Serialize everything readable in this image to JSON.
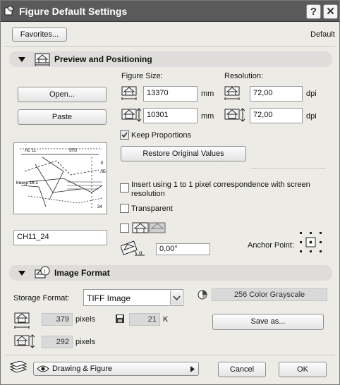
{
  "window": {
    "title": "Figure Default Settings",
    "help_glyph": "?",
    "close_glyph": "✕"
  },
  "top": {
    "favorites_label": "Favorites...",
    "default_label": "Default"
  },
  "preview_section": {
    "title": "Preview and Positioning",
    "figure_size_label": "Figure Size:",
    "resolution_label": "Resolution:",
    "width_value": "13370",
    "height_value": "10301",
    "unit_mm": "mm",
    "res_width_value": "72,00",
    "res_height_value": "72,00",
    "unit_dpi": "dpi",
    "open_label": "Open...",
    "paste_label": "Paste",
    "keep_proportions_label": "Keep Proportions",
    "keep_proportions_checked": true,
    "restore_label": "Restore Original Values",
    "insert_pixel_label": "Insert using 1 to 1 pixel correspondence with screen resolution",
    "transparent_label": "Transparent",
    "filename_value": "CH11_24",
    "angle_value": "0,00°",
    "anchor_label": "Anchor Point:",
    "preview_texts": [
      "ЛС 11",
      "5П3",
      "Кмеур 18-2",
      "34",
      "ЛБ",
      "К"
    ]
  },
  "image_section": {
    "title": "Image Format",
    "storage_label": "Storage Format:",
    "storage_value": "TIFF Image",
    "color_value": "256 Color Grayscale",
    "width_pixels": "379",
    "height_pixels": "292",
    "pixels_unit": "pixels",
    "file_size": "21",
    "file_size_unit": "K",
    "save_as_label": "Save as..."
  },
  "bottom": {
    "layer_label": "Drawing & Figure",
    "cancel_label": "Cancel",
    "ok_label": "OK"
  }
}
